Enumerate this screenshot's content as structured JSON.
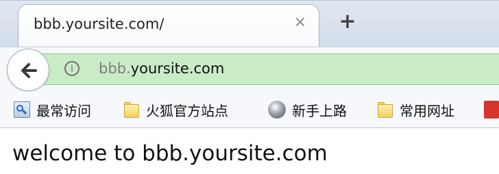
{
  "tab": {
    "title": "bbb.yoursite.com/",
    "close_glyph": "×",
    "new_tab_glyph": "+"
  },
  "navbar": {
    "back_icon": "back-arrow-icon",
    "info_icon": "info-icon",
    "info_glyph": "i",
    "url_prefix": "bbb.",
    "url_domain": "yoursite.com",
    "urlbar_color": "#c9ecc6"
  },
  "bookmarks": [
    {
      "label": "最常访问",
      "icon": "history-icon"
    },
    {
      "label": "火狐官方站点",
      "icon": "folder-icon"
    },
    {
      "label": "新手上路",
      "icon": "globe-icon"
    },
    {
      "label": "常用网址",
      "icon": "folder-icon"
    },
    {
      "label": "",
      "icon": "red-app-icon"
    }
  ],
  "page": {
    "heading": "welcome to bbb.yoursite.com"
  }
}
